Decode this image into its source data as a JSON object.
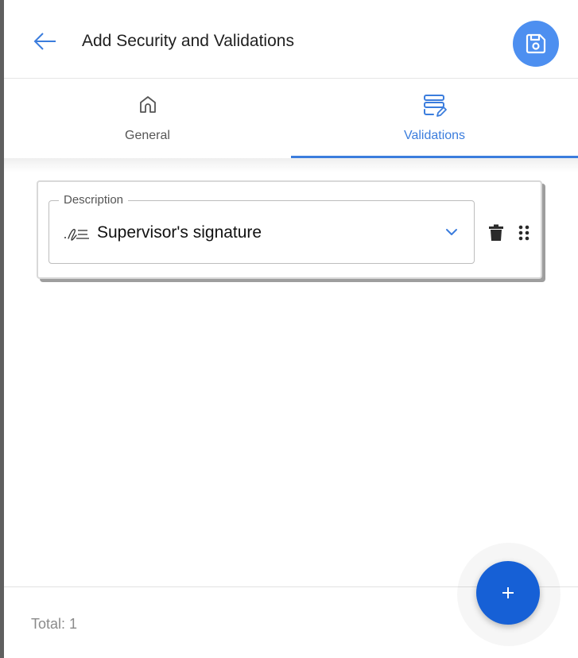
{
  "header": {
    "title": "Add Security and Validations",
    "back_icon": "arrow-left-icon",
    "save_icon": "floppy-disk-icon"
  },
  "tabs": [
    {
      "label": "General",
      "icon": "home-icon",
      "active": false
    },
    {
      "label": "Validations",
      "icon": "list-edit-icon",
      "active": true
    }
  ],
  "validation_item": {
    "field_label": "Description",
    "value": "Supervisor's signature",
    "value_icon": "signature-icon",
    "dropdown_icon": "chevron-down-icon",
    "delete_icon": "trash-icon",
    "drag_icon": "drag-handle-icon"
  },
  "footer": {
    "total_label": "Total: 1"
  },
  "fab": {
    "icon": "plus-icon"
  },
  "colors": {
    "accent": "#3b7ddd",
    "save_button": "#4d8ff0",
    "fab": "#1660d6"
  }
}
